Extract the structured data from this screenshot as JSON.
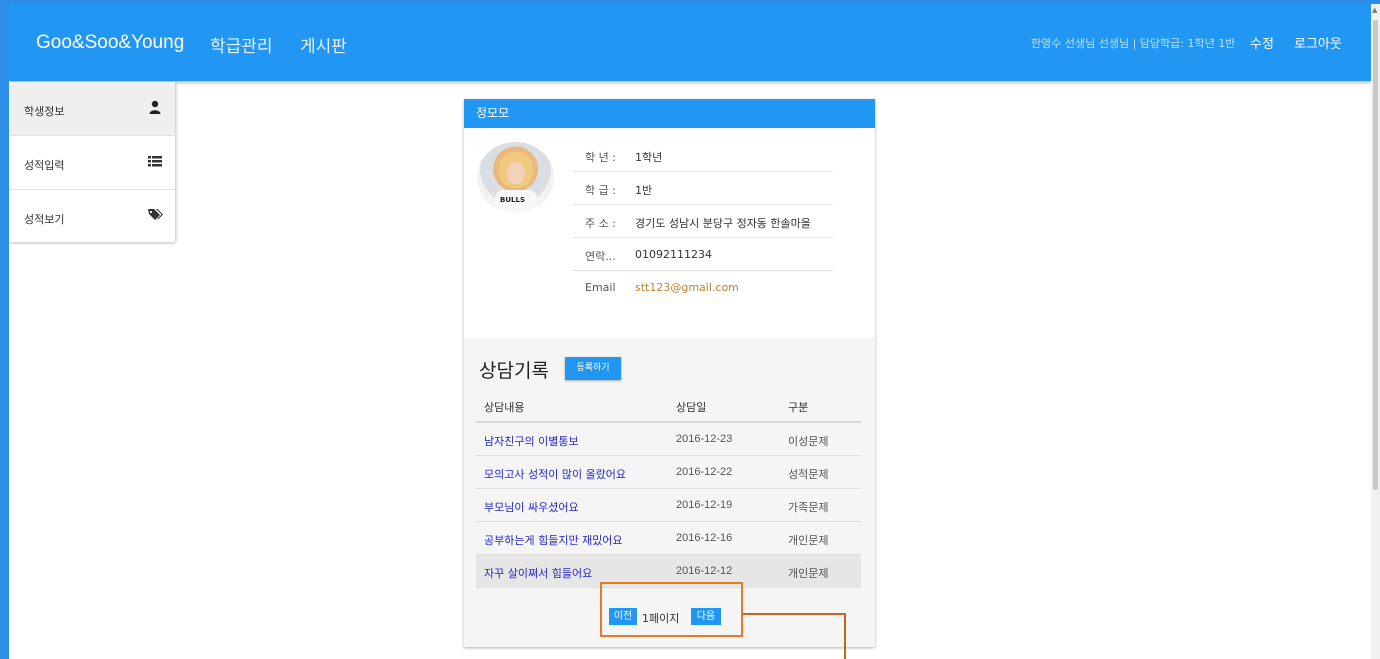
{
  "navbar": {
    "brand": "Goo&Soo&Young",
    "links": [
      "학급관리",
      "게시판"
    ],
    "user_info": "한영수 선생님 선생님 | 담당학급: 1학년 1반",
    "edit_label": "수정",
    "logout_label": "로그아웃"
  },
  "sidebar": {
    "items": [
      {
        "label": "학생정보",
        "icon": "user-icon"
      },
      {
        "label": "성적입력",
        "icon": "list-icon"
      },
      {
        "label": "성적보기",
        "icon": "tags-icon"
      }
    ]
  },
  "student": {
    "name": "정모모",
    "avatar_shirt_text": "BULLS",
    "fields": [
      {
        "key": "학 년 :",
        "value": "1학년"
      },
      {
        "key": "학 급 :",
        "value": "1반"
      },
      {
        "key": "주 소 :",
        "value": "경기도 성남시 분당구 정자동 한솔마을"
      },
      {
        "key": "연락...",
        "value": "01092111234"
      },
      {
        "key": "Email",
        "value": "stt123@gmail.com"
      }
    ]
  },
  "consult": {
    "title": "상담기록",
    "register_label": "등록하기",
    "columns": [
      "상담내용",
      "상담일",
      "구분"
    ],
    "rows": [
      {
        "content": "남자친구의 이별통보",
        "date": "2016-12-23",
        "category": "이성문제"
      },
      {
        "content": "모의고사 성적이 많이 올랐어요",
        "date": "2016-12-22",
        "category": "성적문제"
      },
      {
        "content": "부모님이 싸우셨어요",
        "date": "2016-12-19",
        "category": "가족문제"
      },
      {
        "content": "공부하는게 힘들지만 재밌어요",
        "date": "2016-12-16",
        "category": "개인문제"
      },
      {
        "content": "자꾸 살이쪄서 힘들어요",
        "date": "2016-12-12",
        "category": "개인문제"
      }
    ],
    "pager": {
      "prev_label": "이전",
      "page_text": "1페이지",
      "next_label": "다음"
    }
  },
  "colors": {
    "primary": "#2196f3",
    "link": "#2727c9",
    "email": "#c0832d",
    "annotation": "#e77a26"
  }
}
